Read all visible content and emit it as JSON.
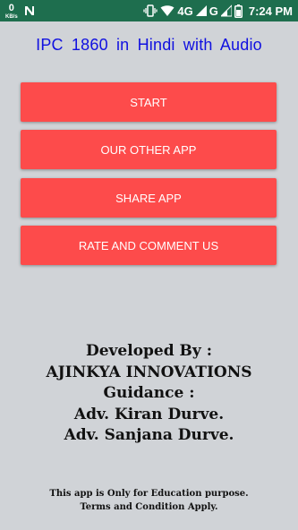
{
  "status_bar": {
    "speed_value": "0",
    "speed_unit": "KB/s",
    "network_label_1": "4G",
    "network_label_2": "G",
    "time": "7:24 PM",
    "colors": {
      "background": "#1e6e4e",
      "text": "#ffffff"
    },
    "icons": [
      "no-sim-icon",
      "vibrate-icon",
      "wifi-icon",
      "signal-icon",
      "signal-icon",
      "battery-icon"
    ]
  },
  "app": {
    "title": "IPC 1860 in Hindi with Audio",
    "title_color": "#1010e0",
    "background": "#d0d3d7"
  },
  "buttons": {
    "start": "START",
    "other_app": "OUR OTHER APP",
    "share_app": "SHARE APP",
    "rate": "RATE AND COMMENT US",
    "color": "#fd4b4b"
  },
  "credits": {
    "developed_by": "Developed By :",
    "company": "AJINKYA INNOVATIONS",
    "guidance": "Guidance :",
    "person_1": "Adv. Kiran Durve.",
    "person_2": "Adv. Sanjana Durve."
  },
  "footer": {
    "line_1": "This app is Only for Education purpose.",
    "line_2": "Terms and Condition Apply."
  }
}
